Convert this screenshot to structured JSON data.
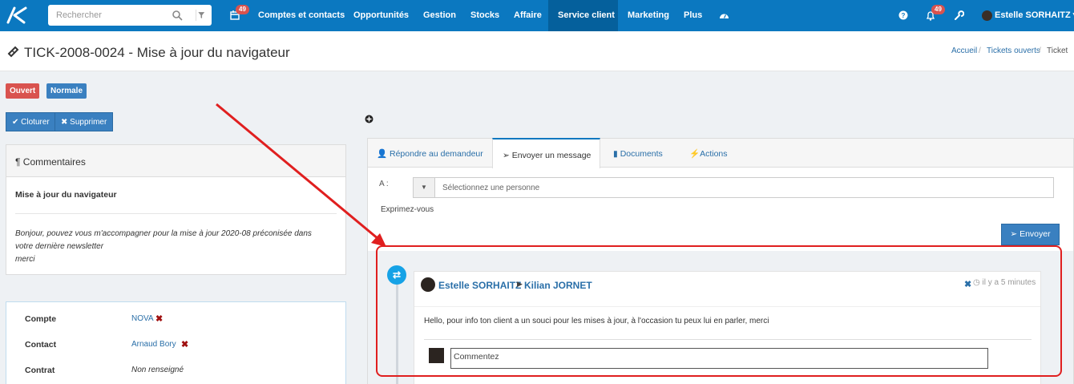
{
  "nav": {
    "search_placeholder": "Rechercher",
    "calendar_badge": "49",
    "items": [
      "Comptes et contacts",
      "Opportunités",
      "Gestion",
      "Stocks",
      "Affaire",
      "Service client",
      "Marketing",
      "Plus"
    ],
    "notif_badge": "49",
    "user": "Estelle SORHAITZ"
  },
  "page": {
    "title": "TICK-2008-0024 - Mise à jour du navigateur",
    "breadcrumb": [
      "Accueil",
      "Tickets ouverts",
      "Ticket"
    ]
  },
  "labels": {
    "status": "Ouvert",
    "priority": "Normale"
  },
  "buttons": {
    "close": "Cloturer",
    "delete": "Supprimer"
  },
  "comments": {
    "header": "Commentaires",
    "subject": "Mise à jour du navigateur",
    "body_line1": "Bonjour, pouvez vous m'accompagner pour la mise à jour 2020-08 préconisée dans",
    "body_line2": "votre dernière newsletter",
    "body_line3": "merci"
  },
  "details": [
    {
      "label": "Compte",
      "value": "NOVA"
    },
    {
      "label": "Contact",
      "value": "Arnaud Bory"
    },
    {
      "label": "Contrat",
      "value": "Non renseigné"
    }
  ],
  "tabs": [
    "Répondre au demandeur",
    "Envoyer un message",
    "Documents",
    "Actions"
  ],
  "message_form": {
    "to_label": "A :",
    "to_placeholder": "Sélectionnez une personne",
    "express_label": "Exprimez-vous",
    "send": "Envoyer"
  },
  "timeline": {
    "from": "Estelle SORHAITZ",
    "to": "Kilian JORNET",
    "time": "il y a 5 minutes",
    "text": "Hello, pour info ton client a un souci pour les mises à jour, à l'occasion tu peux lui en parler, merci",
    "comment_placeholder": "Commentez"
  },
  "colors": {
    "nav": "#0b78c0",
    "danger": "#d9534f",
    "primary": "#3a80c0",
    "annotation": "#e01f1f"
  }
}
